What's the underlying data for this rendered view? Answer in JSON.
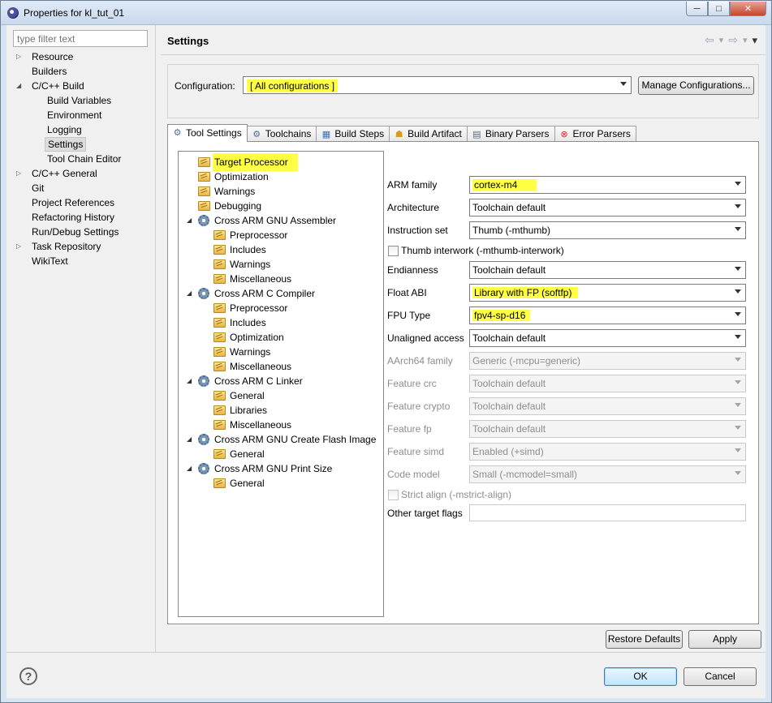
{
  "window": {
    "title": "Properties for kl_tut_01",
    "minimize": "─",
    "maximize": "□",
    "close": "✕"
  },
  "nav": {
    "filter_placeholder": "type filter text",
    "items": [
      {
        "label": "Resource",
        "level": 0,
        "expander": "▷"
      },
      {
        "label": "Builders",
        "level": 0,
        "expander": ""
      },
      {
        "label": "C/C++ Build",
        "level": 0,
        "expander": "◢"
      },
      {
        "label": "Build Variables",
        "level": 1,
        "expander": ""
      },
      {
        "label": "Environment",
        "level": 1,
        "expander": ""
      },
      {
        "label": "Logging",
        "level": 1,
        "expander": ""
      },
      {
        "label": "Settings",
        "level": 1,
        "expander": "",
        "selected": true
      },
      {
        "label": "Tool Chain Editor",
        "level": 1,
        "expander": ""
      },
      {
        "label": "C/C++ General",
        "level": 0,
        "expander": "▷"
      },
      {
        "label": "Git",
        "level": 0,
        "expander": ""
      },
      {
        "label": "Project References",
        "level": 0,
        "expander": ""
      },
      {
        "label": "Refactoring History",
        "level": 0,
        "expander": ""
      },
      {
        "label": "Run/Debug Settings",
        "level": 0,
        "expander": ""
      },
      {
        "label": "Task Repository",
        "level": 0,
        "expander": "▷"
      },
      {
        "label": "WikiText",
        "level": 0,
        "expander": ""
      }
    ]
  },
  "page": {
    "title": "Settings",
    "back_icon": "⇦",
    "forward_icon": "⇨",
    "menu_icon": "▾"
  },
  "configuration": {
    "label": "Configuration:",
    "value": "[ All configurations ]",
    "manage_button": "Manage Configurations..."
  },
  "tabs": [
    {
      "label": "Tool Settings",
      "icon": "⚙",
      "active": true
    },
    {
      "label": "Toolchains",
      "icon": "⚙",
      "active": false
    },
    {
      "label": "Build Steps",
      "icon": "▦",
      "active": false
    },
    {
      "label": "Build Artifact",
      "icon": "☗",
      "active": false
    },
    {
      "label": "Binary Parsers",
      "icon": "▤",
      "active": false
    },
    {
      "label": "Error Parsers",
      "icon": "⊗",
      "active": false
    }
  ],
  "tool_tree": [
    {
      "label": "Target Processor",
      "indent": 1,
      "icon": "folder",
      "highlighted": true
    },
    {
      "label": "Optimization",
      "indent": 1,
      "icon": "folder"
    },
    {
      "label": "Warnings",
      "indent": 1,
      "icon": "folder"
    },
    {
      "label": "Debugging",
      "indent": 1,
      "icon": "folder"
    },
    {
      "label": "Cross ARM GNU Assembler",
      "indent": 0,
      "icon": "gear",
      "expander": "◢"
    },
    {
      "label": "Preprocessor",
      "indent": 2,
      "icon": "folder"
    },
    {
      "label": "Includes",
      "indent": 2,
      "icon": "folder"
    },
    {
      "label": "Warnings",
      "indent": 2,
      "icon": "folder"
    },
    {
      "label": "Miscellaneous",
      "indent": 2,
      "icon": "folder"
    },
    {
      "label": "Cross ARM C Compiler",
      "indent": 0,
      "icon": "gear",
      "expander": "◢"
    },
    {
      "label": "Preprocessor",
      "indent": 2,
      "icon": "folder"
    },
    {
      "label": "Includes",
      "indent": 2,
      "icon": "folder"
    },
    {
      "label": "Optimization",
      "indent": 2,
      "icon": "folder"
    },
    {
      "label": "Warnings",
      "indent": 2,
      "icon": "folder"
    },
    {
      "label": "Miscellaneous",
      "indent": 2,
      "icon": "folder"
    },
    {
      "label": "Cross ARM C Linker",
      "indent": 0,
      "icon": "gear",
      "expander": "◢"
    },
    {
      "label": "General",
      "indent": 2,
      "icon": "folder"
    },
    {
      "label": "Libraries",
      "indent": 2,
      "icon": "folder"
    },
    {
      "label": "Miscellaneous",
      "indent": 2,
      "icon": "folder"
    },
    {
      "label": "Cross ARM GNU Create Flash Image",
      "indent": 0,
      "icon": "gear",
      "expander": "◢"
    },
    {
      "label": "General",
      "indent": 2,
      "icon": "folder"
    },
    {
      "label": "Cross ARM GNU Print Size",
      "indent": 0,
      "icon": "gear",
      "expander": "◢"
    },
    {
      "label": "General",
      "indent": 2,
      "icon": "folder"
    }
  ],
  "target_processor": {
    "arm_family": {
      "label": "ARM family",
      "value": "cortex-m4"
    },
    "architecture": {
      "label": "Architecture",
      "value": "Toolchain default"
    },
    "instruction_set": {
      "label": "Instruction set",
      "value": "Thumb (-mthumb)"
    },
    "thumb_interwork": {
      "label": "Thumb interwork (-mthumb-interwork)"
    },
    "endianness": {
      "label": "Endianness",
      "value": "Toolchain default"
    },
    "float_abi": {
      "label": "Float ABI",
      "value": "Library with FP (softfp)"
    },
    "fpu_type": {
      "label": "FPU Type",
      "value": "fpv4-sp-d16"
    },
    "unaligned_access": {
      "label": "Unaligned access",
      "value": "Toolchain default"
    },
    "aarch64_family": {
      "label": "AArch64 family",
      "value": "Generic (-mcpu=generic)"
    },
    "feature_crc": {
      "label": "Feature crc",
      "value": "Toolchain default"
    },
    "feature_crypto": {
      "label": "Feature crypto",
      "value": "Toolchain default"
    },
    "feature_fp": {
      "label": "Feature fp",
      "value": "Toolchain default"
    },
    "feature_simd": {
      "label": "Feature simd",
      "value": "Enabled (+simd)"
    },
    "code_model": {
      "label": "Code model",
      "value": "Small (-mcmodel=small)"
    },
    "strict_align": {
      "label": "Strict align (-mstrict-align)"
    },
    "other_flags": {
      "label": "Other target flags",
      "value": ""
    }
  },
  "buttons": {
    "restore_defaults": "Restore Defaults",
    "apply": "Apply",
    "ok": "OK",
    "cancel": "Cancel",
    "help": "?"
  },
  "colors": {
    "highlight": "#ffff44",
    "selection": "#dcdcdc"
  }
}
